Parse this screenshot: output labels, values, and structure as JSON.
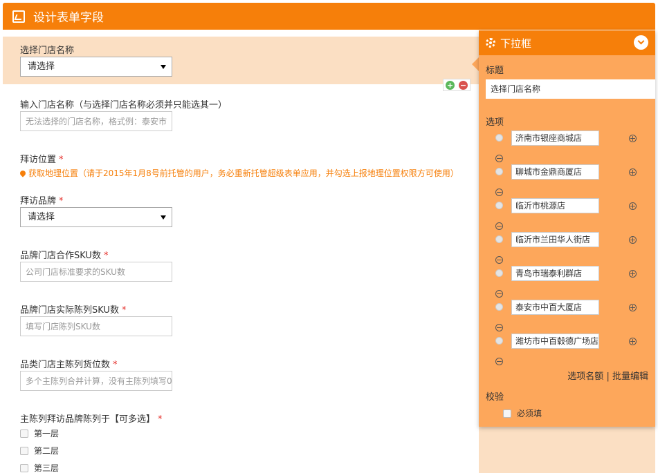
{
  "header": {
    "title": "设计表单字段"
  },
  "form": {
    "store_select": {
      "label": "选择门店名称",
      "value": "请选择"
    },
    "store_input": {
      "label": "输入门店名称（与选择门店名称必须并只能选其一）",
      "placeholder": "无法选择的门店名称，格式例：泰安市"
    },
    "location": {
      "label": "拜访位置",
      "required": "*",
      "link_text": "获取地理位置（请于2015年1月8号前托管的用户，务必重新托管超级表单应用，并勾选上报地理位置权限方可使用）"
    },
    "brand": {
      "label": "拜访品牌",
      "required": "*",
      "value": "请选择"
    },
    "sku_coop": {
      "label": "品牌门店合作SKU数",
      "required": "*",
      "placeholder": "公司门店标准要求的SKU数"
    },
    "sku_actual": {
      "label": "品牌门店实际陈列SKU数",
      "required": "*",
      "placeholder": "填写门店陈列SKU数"
    },
    "shelf": {
      "label": "品类门店主陈列货位数",
      "required": "*",
      "placeholder": "多个主陈列合并计算，没有主陈列填写0"
    },
    "floors": {
      "label": "主陈列拜访品牌陈列于【可多选】",
      "required": "*",
      "options": [
        "第一层",
        "第二层",
        "第三层"
      ]
    }
  },
  "panel": {
    "title": "下拉框",
    "title_label": "标题",
    "title_value": "选择门店名称",
    "options_label": "选项",
    "options": [
      "济南市银座商城店",
      "聊城市金鼎商厦店",
      "临沂市桃源店",
      "临沂市兰田华人街店",
      "青岛市瑞泰利群店",
      "泰安市中百大厦店",
      "潍坊市中百毂德广场店"
    ],
    "link_quota": "选项名额",
    "link_sep": "|",
    "link_batch": "批量编辑",
    "validate_label": "校验",
    "required_check": "必须填"
  },
  "colors": {
    "accent": "#f67f0a",
    "panel": "#fda75b",
    "highlight": "#fbdfc3",
    "required": "#e5322d"
  }
}
